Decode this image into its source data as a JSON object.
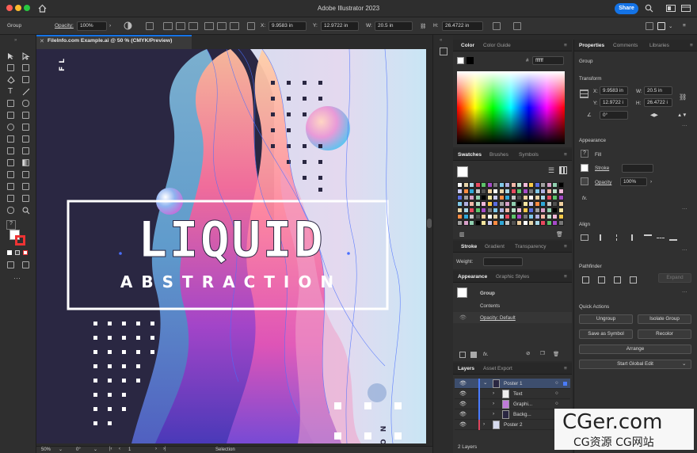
{
  "window": {
    "title": "Adobe Illustrator 2023",
    "share_label": "Share"
  },
  "controlbar": {
    "selection_type": "Group",
    "opacity_label": "Opacity:",
    "opacity_value": "100%",
    "x_label": "X:",
    "x_value": "9.9583 in",
    "y_label": "Y:",
    "y_value": "12.9722 in",
    "w_label": "W:",
    "w_value": "20.5 in",
    "h_label": "H:",
    "h_value": "26.4722 in"
  },
  "document_tab": {
    "label": "FileInfo.com Example.ai @ 50 % (CMYK/Preview)"
  },
  "artwork": {
    "headline": "LIQUID",
    "subheadline": "ABSTRACTION",
    "side_text_top": "FL",
    "side_text_bottom": "O N"
  },
  "statusbar": {
    "zoom": "50%",
    "rotation": "0°",
    "artboard": "1",
    "tool": "Selection"
  },
  "color_panel": {
    "tabs": [
      "Color",
      "Color Guide"
    ],
    "hex_prefix": "#",
    "hex_value": "ffffff"
  },
  "swatches_panel": {
    "tabs": [
      "Swatches",
      "Brushes",
      "Symbols"
    ]
  },
  "stroke_panel": {
    "tabs": [
      "Stroke",
      "Gradient",
      "Transparency"
    ],
    "weight_label": "Weight:"
  },
  "appearance_panel": {
    "tabs": [
      "Appearance",
      "Graphic Styles"
    ],
    "object": "Group",
    "contents": "Contents",
    "opacity": "Opacity: Default",
    "fx": "fx."
  },
  "layers_panel": {
    "tabs": [
      "Layers",
      "Asset Export"
    ],
    "rows": [
      {
        "name": "Poster 1",
        "color": "#4a7cff"
      },
      {
        "name": "Text",
        "color": "#4a7cff"
      },
      {
        "name": "Graphi...",
        "color": "#4a7cff"
      },
      {
        "name": "Backg...",
        "color": "#4a7cff"
      },
      {
        "name": "Poster 2",
        "color": "#e0455e"
      }
    ],
    "count": "2 Layers"
  },
  "properties": {
    "tabs": [
      "Properties",
      "Comments",
      "Libraries"
    ],
    "selection": "Group",
    "transform_title": "Transform",
    "x_label": "X:",
    "x_value": "9.9583 in",
    "y_label": "Y:",
    "y_value": "12.9722 i",
    "w_label": "W:",
    "w_value": "20.5 in",
    "h_label": "H:",
    "h_value": "26.4722 i",
    "angle_value": "0°",
    "appearance_title": "Appearance",
    "fill_label": "Fill",
    "stroke_label": "Stroke",
    "opacity_label": "Opacity",
    "opacity_value": "100%",
    "fx": "fx.",
    "align_title": "Align",
    "pathfinder_title": "Pathfinder",
    "expand_label": "Expand",
    "quick_actions_title": "Quick Actions",
    "ungroup": "Ungroup",
    "isolate_group": "Isolate Group",
    "save_as_symbol": "Save as Symbol",
    "recolor": "Recolor",
    "arrange": "Arrange",
    "start_global_edit": "Start Global Edit"
  },
  "watermark": {
    "main": "CGer.com",
    "sub": "CG资源 CG网站"
  },
  "colors": {
    "accent": "#1473e6",
    "artboard_bg": "#2a2742",
    "panel_bg": "#303030"
  }
}
